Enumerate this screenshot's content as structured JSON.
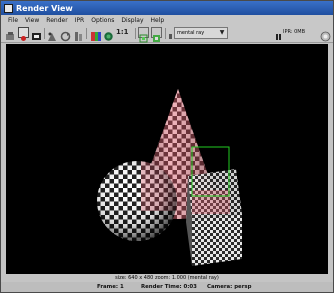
{
  "window": {
    "title": "Render View"
  },
  "menu": [
    "File",
    "View",
    "Render",
    "IPR",
    "Options",
    "Display",
    "Help"
  ],
  "toolbar": {
    "ratio_label": "1:1",
    "renderer": "mental ray",
    "ipr_label": "IPR: 0MB"
  },
  "viewport": {
    "info": "size: 640 x 480  zoom: 1.000     (mental ray)"
  },
  "status": {
    "frame": "Frame: 1",
    "render_time": "Render Time: 0:03",
    "camera": "Camera: persp"
  },
  "colors": {
    "title_bar": "#2a5db0",
    "selection_box": "#22cc22",
    "checker_light": "#ffffff",
    "checker_dark": "#1a1a1a",
    "highlight_red": "#e05a6a"
  }
}
